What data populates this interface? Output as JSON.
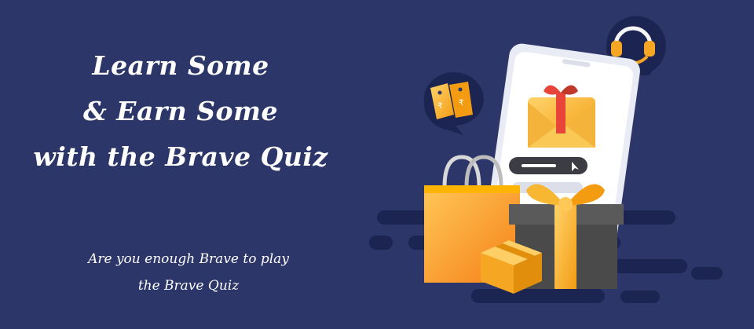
{
  "headline": {
    "line1": "Learn Some",
    "line2": "& Earn Some",
    "line3": "with the Brave Quiz"
  },
  "tagline": {
    "line1": "Are you enough Brave to play",
    "line2": "the Brave Quiz"
  },
  "illustration": {
    "icons": [
      "headphones-icon",
      "price-tags-icon",
      "gift-envelope-icon",
      "shopping-bag-icon",
      "gift-box-icon",
      "cardboard-box-icon"
    ]
  },
  "colors": {
    "background": "#2c3668",
    "accent_orange": "#f5a623",
    "accent_red": "#e8443a",
    "text": "#ffffff"
  }
}
